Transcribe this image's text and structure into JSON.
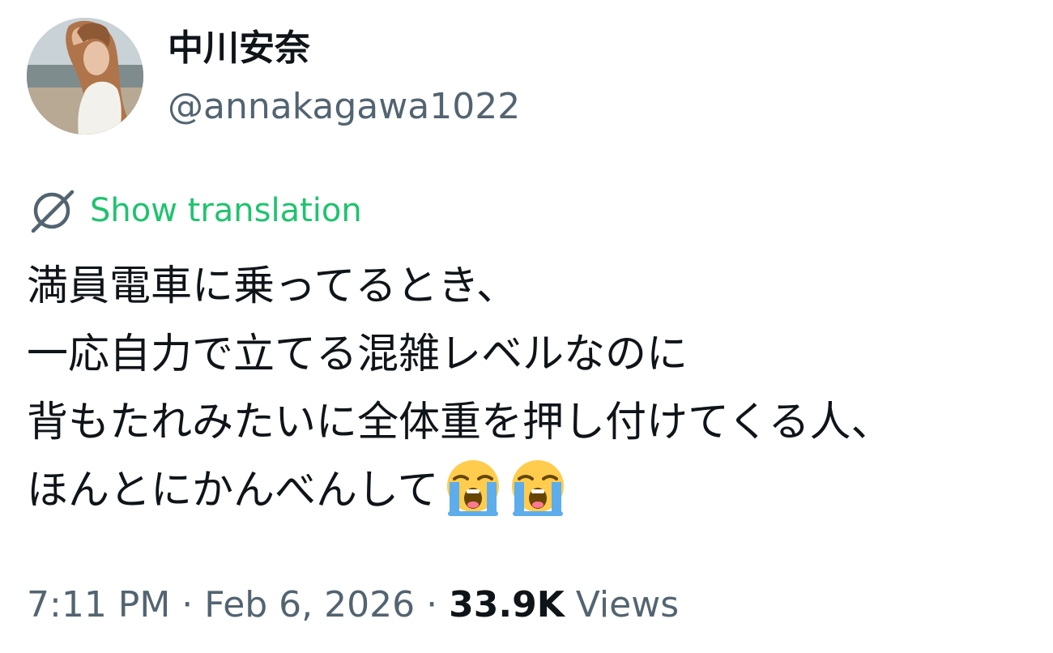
{
  "author": {
    "display_name": "中川安奈",
    "handle": "@annakagawa1022"
  },
  "translate": {
    "icon": "globe-slash-icon",
    "label": "Show translation"
  },
  "tweet": {
    "lines": [
      "満員電車に乗ってるとき、",
      "一応自力で立てる混雑レベルなのに",
      "背もたれみたいに全体重を押し付けてくる人、",
      "ほんとにかんべんして"
    ],
    "emoji": "loudly-crying-face",
    "emoji_count": 2
  },
  "meta": {
    "time": "7:11 PM",
    "separator": "·",
    "date": "Feb 6, 2026",
    "views_count": "33.9K",
    "views_label": "Views"
  },
  "colors": {
    "text": "#0f1419",
    "secondary": "#536471",
    "link": "#1fc36f"
  }
}
